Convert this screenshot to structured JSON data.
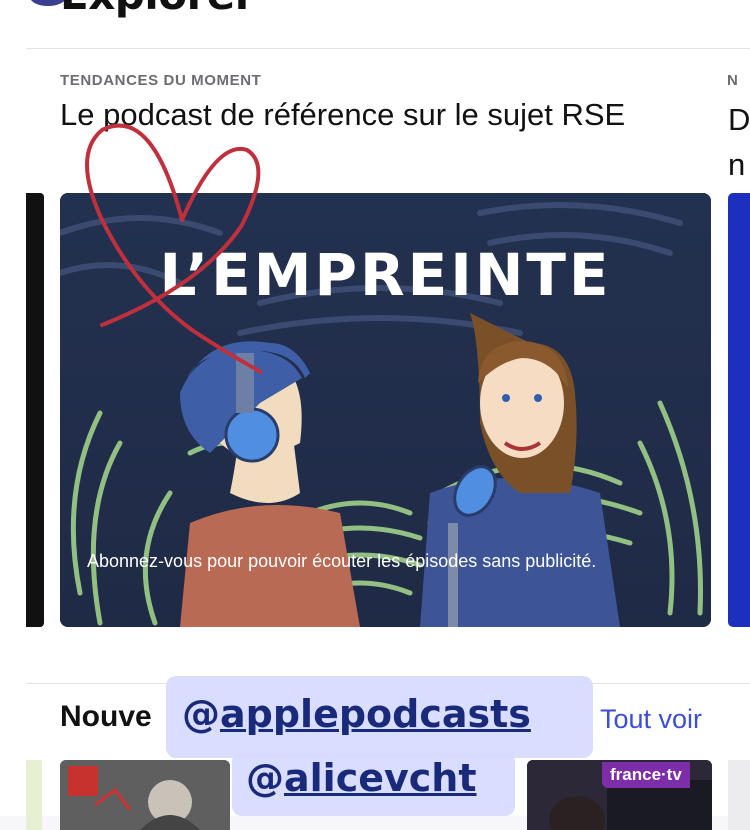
{
  "header": {
    "title": "Explorer"
  },
  "featured": {
    "eyebrow": "TENDANCES DU MOMENT",
    "eyebrow_next": "N",
    "headline": "Le podcast de référence sur le sujet RSE",
    "headline_next_line1": "D",
    "headline_next_line2": "n",
    "card": {
      "title": "L’EMPREINTE",
      "caption": "Abonnez-vous pour pouvoir écouter les épisodes sans publicité."
    }
  },
  "section": {
    "title": "Nouve",
    "see_all": "Tout voir"
  },
  "thumbnails": {
    "brand": "france·tv"
  },
  "stickers": {
    "tag1_at": "@",
    "tag1_handle": "applepodcasts",
    "tag2_at": "@",
    "tag2_handle": "alicevcht"
  },
  "colors": {
    "accent": "#3a4fd6",
    "card_bg": "#25304f",
    "heart": "#c0303c",
    "sticker_text": "#1a2a7a"
  },
  "icons": {
    "heart": "heart-icon"
  }
}
